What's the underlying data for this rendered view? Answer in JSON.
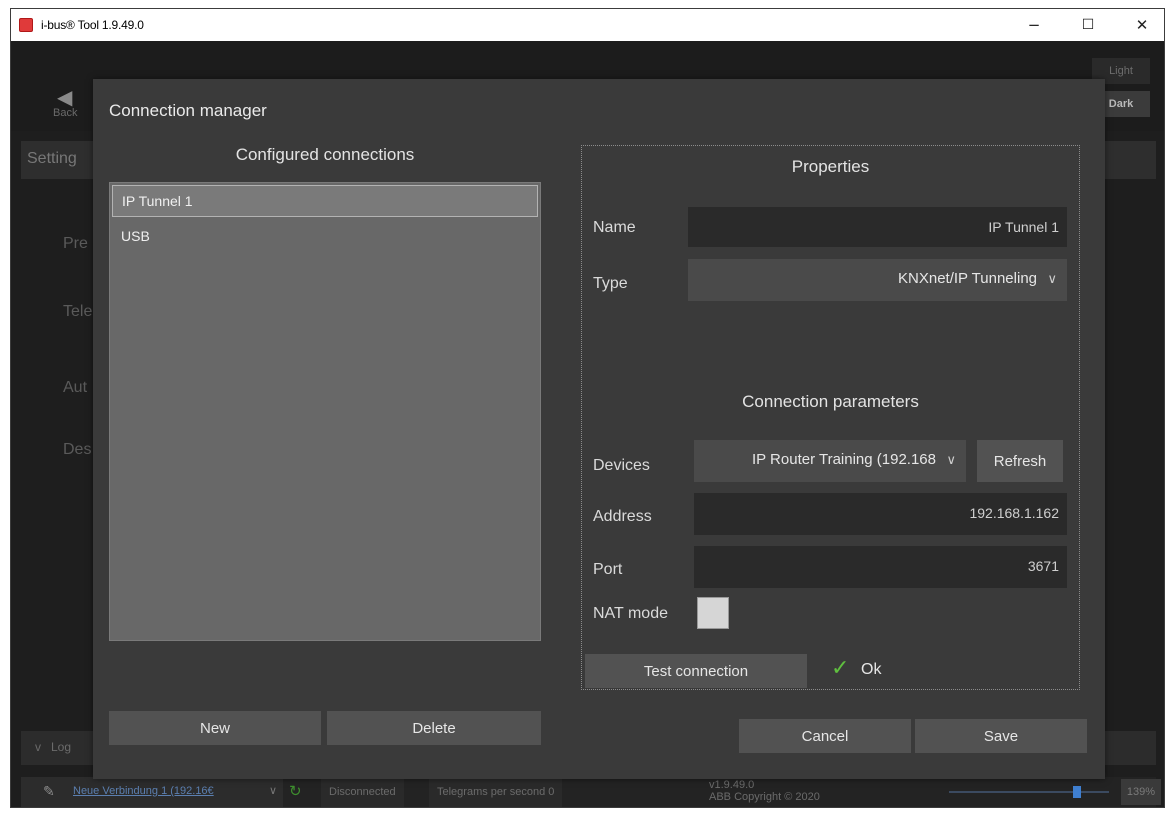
{
  "window": {
    "title": "i-bus® Tool 1.9.49.0",
    "minimize": "−",
    "maximize": "☐",
    "close": "✕"
  },
  "background": {
    "back_label": "Back",
    "help_glyph": "?",
    "theme_light": "Light",
    "theme_dark": "Dark",
    "settings_partial": "Setting",
    "side_items": [
      "Pre",
      "Tele",
      "Aut",
      "Des"
    ],
    "log_label": "Log",
    "log_chevron": "v"
  },
  "statusbar": {
    "connection_name": "Neue Verbindung 1 (192.16€",
    "chevron": "∨",
    "state": "Disconnected",
    "telegrams": "Telegrams per second 0",
    "version": "v1.9.49.0",
    "copyright": "ABB Copyright © 2020",
    "zoom": "139%"
  },
  "dialog": {
    "title": "Connection manager",
    "configured_heading": "Configured connections",
    "connections": [
      {
        "label": "IP Tunnel 1",
        "selected": true
      },
      {
        "label": "USB",
        "selected": false
      }
    ],
    "new_button": "New",
    "delete_button": "Delete",
    "properties_heading": "Properties",
    "name_label": "Name",
    "name_value": "IP Tunnel 1",
    "type_label": "Type",
    "type_value": "KNXnet/IP Tunneling",
    "params_heading": "Connection parameters",
    "devices_label": "Devices",
    "devices_value": "IP Router Training (192.168",
    "refresh_button": "Refresh",
    "address_label": "Address",
    "address_value": "192.168.1.162",
    "port_label": "Port",
    "port_value": "3671",
    "nat_label": "NAT mode",
    "nat_checked": false,
    "test_button": "Test connection",
    "test_result": "Ok",
    "cancel_button": "Cancel",
    "save_button": "Save"
  },
  "colors": {
    "dialog_bg": "#3a3a3a",
    "list_bg": "#686868",
    "ok_green": "#5fbf3f",
    "link_blue": "#5b7fb0"
  }
}
